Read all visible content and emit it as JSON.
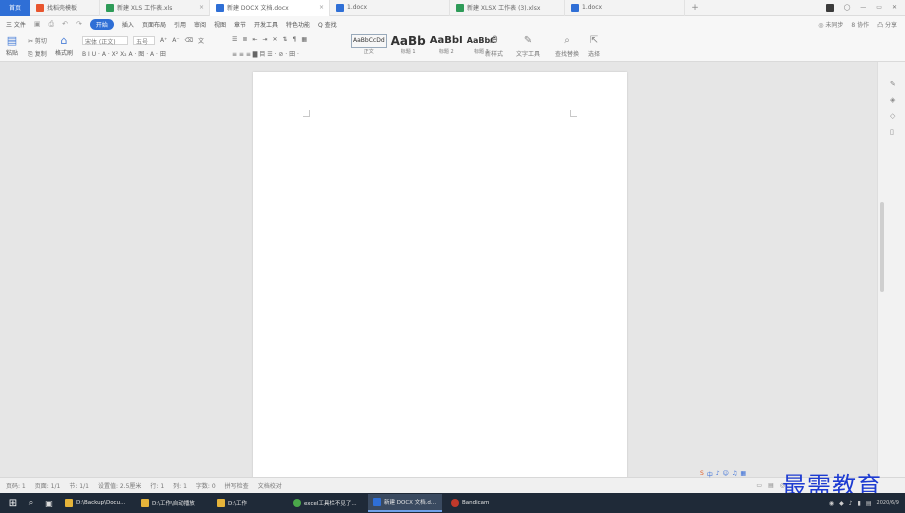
{
  "tabbar": {
    "home_label": "首页",
    "tabs": [
      {
        "label": "找稻壳模板",
        "color": "#e8552e",
        "active": false
      },
      {
        "label": "新建 XLS 工作表.xls",
        "color": "#2e9b58",
        "active": false
      },
      {
        "label": "新建 DOCX 文档.docx",
        "color": "#2f6fd6",
        "active": true
      },
      {
        "label": "1.docx",
        "color": "#2f6fd6",
        "active": false
      },
      {
        "label": "新建 XLSX 工作表 (3).xlsx",
        "color": "#2e9b58",
        "active": false
      },
      {
        "label": "1.docx",
        "color": "#2f6fd6",
        "active": false
      }
    ],
    "plus": "+"
  },
  "menubar": {
    "file": "三 文件",
    "items": [
      "开始",
      "插入",
      "页面布局",
      "引用",
      "审阅",
      "视图",
      "章节",
      "开发工具",
      "特色功能",
      "Q 查找"
    ],
    "active_item": "开始",
    "right": [
      "◎ 未同步",
      "8 协作",
      "凸 分享"
    ]
  },
  "ribbon": {
    "paste": "粘贴",
    "cut": "✂ 剪切",
    "copy": "⎘ 复制",
    "format_painter": "格式刷",
    "font_name": "宋体 (正文)",
    "font_size": "五号",
    "format_row": "B I U · A · X² X₂ A · 图 · A · 田",
    "para_row": "≡ ≡ ≡ ▇ 目 ☰ · ⊘ · 田 ·",
    "styles": [
      {
        "sample": "AaBbCcDd",
        "label": "正文"
      },
      {
        "sample": "AaBb",
        "label": "标题 1"
      },
      {
        "sample": "AaBbI",
        "label": "标题 2"
      },
      {
        "sample": "AaBbC",
        "label": "标题 3"
      }
    ],
    "text_tools": "文字工具",
    "new_style": "新样式",
    "find_replace": "查找替换",
    "select": "选择"
  },
  "statusbar": {
    "items": [
      "页码: 1",
      "页面: 1/1",
      "节: 1/1",
      "设置值: 2.5厘米",
      "行: 1",
      "列: 1",
      "字数: 0",
      "拼写检查",
      "文档校对"
    ]
  },
  "taskbar": {
    "items": [
      {
        "label": "D:\\Backup\\Docu...",
        "color": "#e6b43a",
        "active": false
      },
      {
        "label": "D:\\工作\\自动播放",
        "color": "#e6b43a",
        "active": false
      },
      {
        "label": "D:\\工作",
        "color": "#e6b43a",
        "active": false
      },
      {
        "label": "excel工具栏不见了...",
        "color": "#4aa84a",
        "active": false
      },
      {
        "label": "新建 DOCX 文档.d...",
        "color": "#2f6fd6",
        "active": true
      },
      {
        "label": "Bandicam",
        "color": "#c0392b",
        "active": false
      }
    ],
    "clock_time": "",
    "clock_date": "2020/6/9"
  },
  "watermark": "最需教育"
}
